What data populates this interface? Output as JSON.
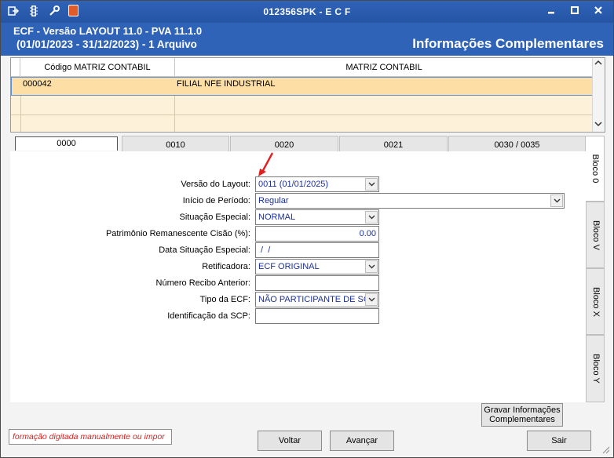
{
  "window": {
    "title": "012356SPK - E C F",
    "toolbar_icons": [
      "export-icon",
      "traffic-light-icon",
      "wrench-icon",
      "book-icon"
    ],
    "controls": [
      "minimize",
      "maximize",
      "close"
    ]
  },
  "header": {
    "line1": "ECF - Versão LAYOUT 11.0 - PVA 11.1.0",
    "line2": "(01/01/2023 - 31/12/2023) - 1 Arquivo",
    "section_title": "Informações Complementares"
  },
  "grid": {
    "columns": [
      "Código MATRIZ CONTABIL",
      "MATRIZ CONTABIL"
    ],
    "rows": [
      {
        "codigo": "000042",
        "matriz": "FILIAL NFE INDUSTRIAL"
      }
    ]
  },
  "tabs": {
    "items": [
      "0000",
      "0010",
      "0020",
      "0021",
      "0030 / 0035"
    ],
    "active": "0000"
  },
  "side_tabs": {
    "items": [
      "Bloco 0",
      "Bloco V",
      "Bloco X",
      "Bloco Y"
    ],
    "active": "Bloco 0"
  },
  "form": {
    "versao_layout": {
      "label": "Versão do Layout:",
      "value": "0011 (01/01/2025)"
    },
    "inicio_periodo": {
      "label": "Início de Período:",
      "value": "Regular"
    },
    "situacao_especial": {
      "label": "Situação Especial:",
      "value": "NORMAL"
    },
    "patrimonio": {
      "label": "Patrimônio Remanescente Cisão (%):",
      "value": "0.00"
    },
    "data_situacao": {
      "label": "Data Situação Especial:",
      "value": " /  /"
    },
    "retificadora": {
      "label": "Retificadora:",
      "value": "ECF ORIGINAL"
    },
    "numero_recibo": {
      "label": "Número Recibo Anterior:",
      "value": ""
    },
    "tipo_ecf": {
      "label": "Tipo da ECF:",
      "value": "NÃO PARTICIPANTE DE SCP"
    },
    "identificacao_scp": {
      "label": "Identificação da SCP:",
      "value": ""
    }
  },
  "buttons": {
    "gravar_line1": "Gravar Informações",
    "gravar_line2": "Complementares",
    "voltar": "Voltar",
    "avancar": "Avançar",
    "sair": "Sair"
  },
  "status": {
    "message": "formação digitada manualmente ou impor"
  },
  "colors": {
    "titlebar": "#2f63b8",
    "grid_background": "#fdf1d9",
    "grid_selected_row": "#fddfa5",
    "field_text": "#1a2fa0",
    "status_text": "#d11f1f",
    "annotation_arrow": "#e02020"
  }
}
